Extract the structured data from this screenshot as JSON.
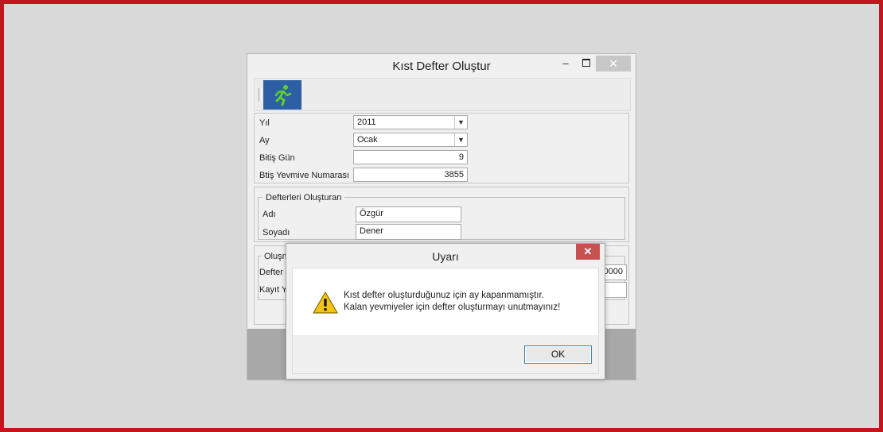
{
  "window": {
    "title": "Kıst Defter Oluştur",
    "minimize_glyph": "–",
    "close_glyph": "✕"
  },
  "toolbar": {
    "exit_icon": "running-exit-icon"
  },
  "form": {
    "year_label": "Yıl",
    "year_value": "2011",
    "month_label": "Ay",
    "month_value": "Ocak",
    "end_day_label": "Bitiş Gün",
    "end_day_value": "9",
    "end_journal_label": "Btiş Yevmive Numarası",
    "end_journal_value": "3855"
  },
  "creators": {
    "group_title": "Defterleri Oluşturan",
    "name_label": "Adı",
    "name_value": "Özgür",
    "surname_label": "Soyadı",
    "surname_value": "Dener"
  },
  "created": {
    "group_title_partial": "Oluşm",
    "defter_label_partial": "Defter",
    "kayit_label_partial": "Kayıt Y",
    "value_partial": "0000"
  },
  "dialog": {
    "title": "Uyarı",
    "close_glyph": "✕",
    "message_line1": "Kıst defter oluşturduğunuz için ay kapanmamıştır.",
    "message_line2": "Kalan yevmiyeler için defter oluşturmayı unutmayınız!",
    "ok_label": "OK"
  },
  "colors": {
    "frame": "#c0161c",
    "toolbar_button": "#2c5fa3",
    "dialog_close": "#c75050",
    "warning_yellow": "#f3c316"
  }
}
